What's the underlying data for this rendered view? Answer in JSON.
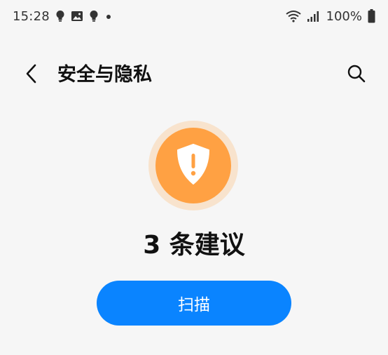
{
  "status_bar": {
    "time": "15:28",
    "battery": "100%",
    "left_icons": [
      "lightbulb-icon",
      "image-icon",
      "lightbulb-icon",
      "dot-icon"
    ],
    "right_icons": [
      "wifi-icon",
      "signal-icon",
      "battery-icon"
    ]
  },
  "header": {
    "title": "安全与隐私",
    "back_icon": "chevron-left-icon",
    "search_icon": "search-icon"
  },
  "main": {
    "status_icon": "shield-alert-icon",
    "suggestion_count_text": "3 条建议",
    "scan_button_label": "扫描"
  },
  "colors": {
    "background": "#f6f6f6",
    "shield_orange": "#ffa143",
    "shield_halo": "#f8e3cd",
    "accent_blue": "#0a84ff"
  }
}
